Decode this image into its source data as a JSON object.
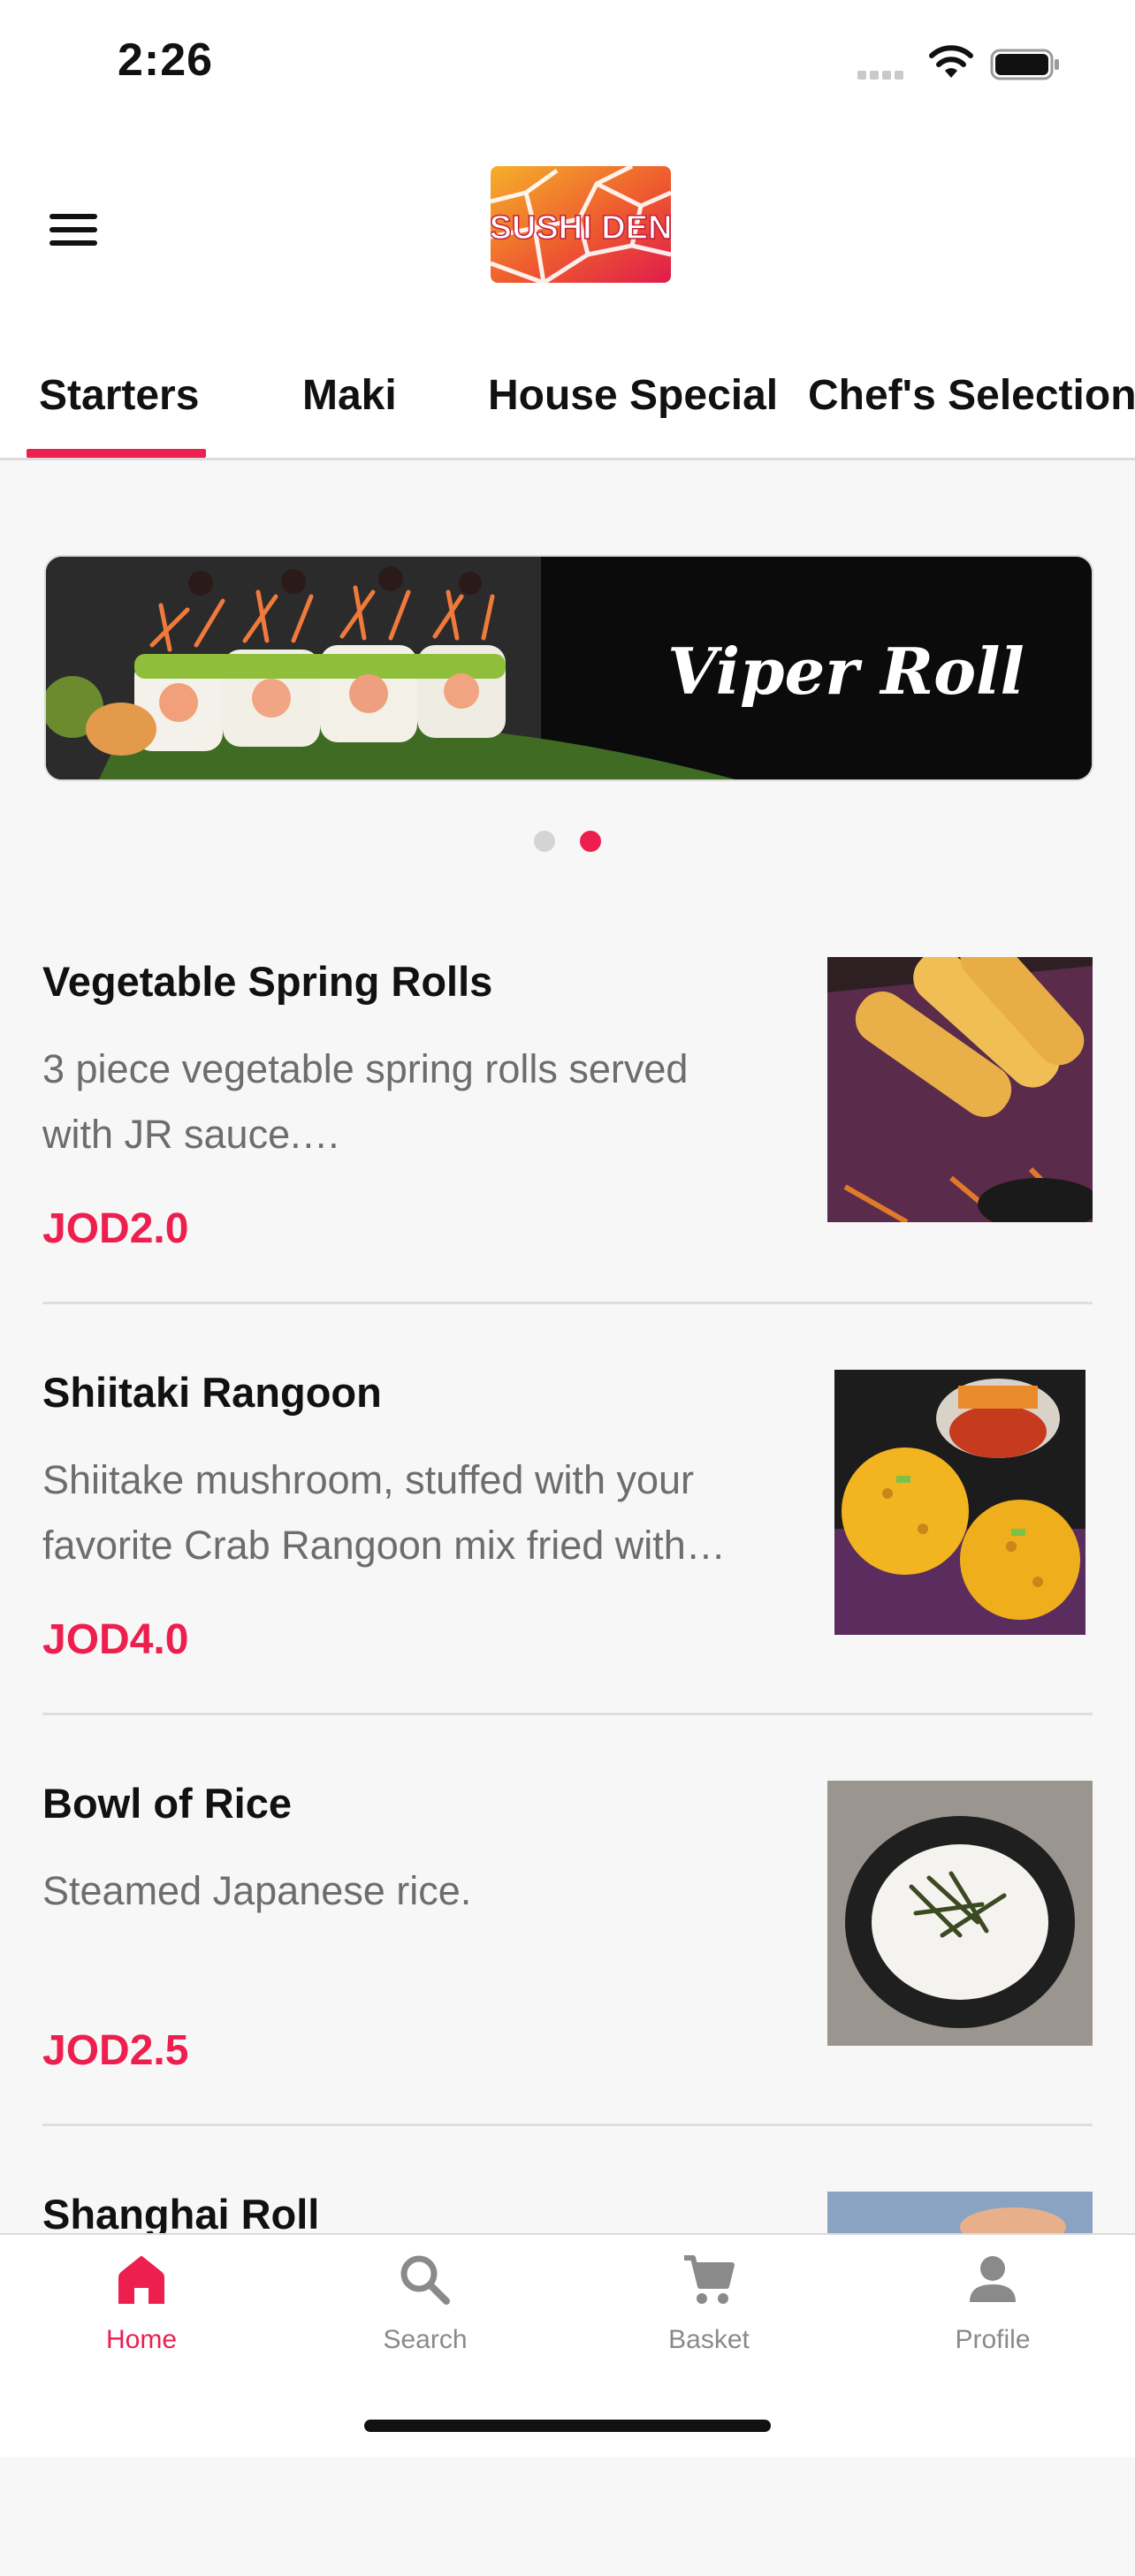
{
  "status_bar": {
    "time": "2:26"
  },
  "header": {
    "logo_text": "SUSHI DEN"
  },
  "tabs": [
    {
      "label": "Starters",
      "active": true
    },
    {
      "label": "Maki",
      "active": false
    },
    {
      "label": "House Special",
      "active": false
    },
    {
      "label": "Chef's Selection",
      "active": false
    }
  ],
  "banner": {
    "title": "Viper Roll",
    "slides": 2,
    "active_slide": 2
  },
  "menu_items": [
    {
      "title": "Vegetable Spring Rolls",
      "description_lines": [
        "3 piece vegetable spring rolls served",
        "with JR sauce.…"
      ],
      "price": "JOD2.0"
    },
    {
      "title": "Shiitaki Rangoon",
      "description_lines": [
        "Shiitake mushroom, stuffed with your",
        "favorite Crab Rangoon mix fried with…"
      ],
      "price": "JOD4.0"
    },
    {
      "title": "Bowl of Rice",
      "description_lines": [
        "Steamed Japanese rice."
      ],
      "price": "JOD2.5"
    },
    {
      "title": "Shanghai Roll",
      "description_lines": [],
      "price": ""
    }
  ],
  "bottom_nav": [
    {
      "label": "Home",
      "icon": "home-icon",
      "active": true
    },
    {
      "label": "Search",
      "icon": "search-icon",
      "active": false
    },
    {
      "label": "Basket",
      "icon": "cart-icon",
      "active": false
    },
    {
      "label": "Profile",
      "icon": "profile-icon",
      "active": false
    }
  ],
  "colors": {
    "accent": "#ec1f4f",
    "inactive": "#8a8a8a",
    "background": "#f7f7f7"
  }
}
